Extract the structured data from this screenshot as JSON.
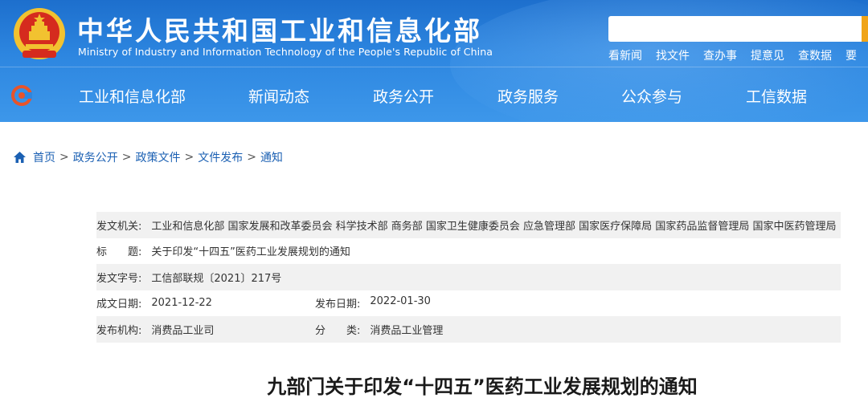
{
  "header": {
    "title_cn": "中华人民共和国工业和信息化部",
    "title_en": "Ministry of Industry and Information Technology of the People's Republic of China",
    "search": {
      "placeholder": "",
      "value": ""
    },
    "quick_links": [
      "看新闻",
      "找文件",
      "查办事",
      "提意见",
      "查数据",
      "要"
    ],
    "brand_colors": {
      "header_blue": "#1d6fcd",
      "search_button": "#f0a418"
    }
  },
  "nav": {
    "items": [
      "工业和信息化部",
      "新闻动态",
      "政务公开",
      "政务服务",
      "公众参与",
      "工信数据"
    ]
  },
  "breadcrumb": {
    "items": [
      "首页",
      "政务公开",
      "政策文件",
      "文件发布",
      "通知"
    ],
    "separator": ">"
  },
  "info": {
    "issuer_label": "发文机关:",
    "issuer_value": "工业和信息化部 国家发展和改革委员会 科学技术部 商务部 国家卫生健康委员会 应急管理部 国家医疗保障局 国家药品监督管理局 国家中医药管理局",
    "title_label": "标　　题:",
    "title_value": "关于印发“十四五”医药工业发展规划的通知",
    "docno_label": "发文字号:",
    "docno_value": "工信部联规〔2021〕217号",
    "created_label": "成文日期:",
    "created_value": "2021-12-22",
    "published_label": "发布日期:",
    "published_value": "2022-01-30",
    "org_label": "发布机构:",
    "org_value": "消费品工业司",
    "category_label": "分　　类:",
    "category_value": "消费品工业管理"
  },
  "document": {
    "title": "九部门关于印发“十四五”医药工业发展规划的通知"
  }
}
